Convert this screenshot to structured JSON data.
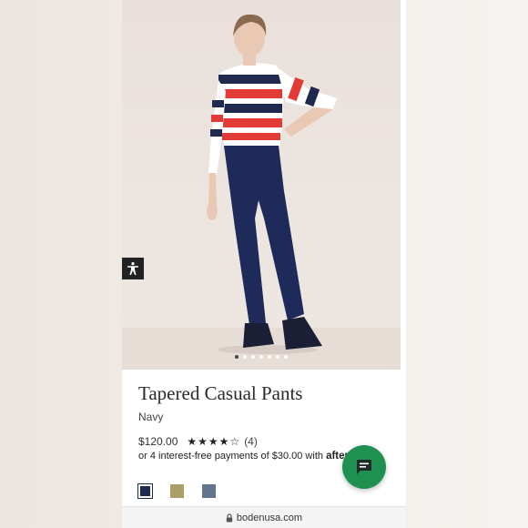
{
  "product": {
    "title": "Tapered Casual Pants",
    "color_name": "Navy",
    "price": "$120.00",
    "rating_stars": "★★★★☆",
    "rating_count": "(4)",
    "installments_text": "or 4 interest-free payments of $30.00 with",
    "installments_brand": "afterpay",
    "swatches": [
      {
        "name": "Navy",
        "color": "#1f2a4e",
        "selected": true
      },
      {
        "name": "Olive",
        "color": "#a8a067",
        "selected": false
      },
      {
        "name": "Blue",
        "color": "#61758f",
        "selected": false
      }
    ]
  },
  "carousel": {
    "total_dots": 7,
    "active_index": 0
  },
  "browser": {
    "url": "bodenusa.com"
  },
  "icons": {
    "accessibility": "accessibility-icon",
    "chat": "chat-icon",
    "lock": "lock-icon"
  },
  "colors": {
    "chat_button": "#1e9150",
    "accent_text": "#2a2a2a"
  }
}
